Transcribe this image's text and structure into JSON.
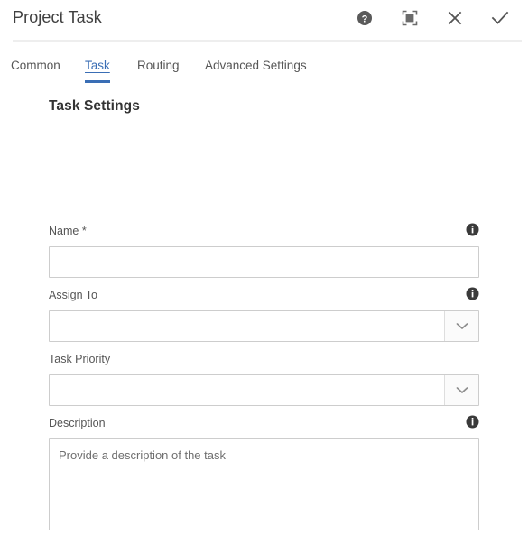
{
  "header": {
    "title": "Project Task",
    "actions": [
      {
        "name": "help-icon",
        "label": "Help"
      },
      {
        "name": "maximize-icon",
        "label": "Maximize"
      },
      {
        "name": "close-icon",
        "label": "Close"
      },
      {
        "name": "confirm-check-icon",
        "label": "Apply"
      }
    ]
  },
  "tabs": [
    {
      "label": "Common",
      "active": false
    },
    {
      "label": "Task",
      "active": true
    },
    {
      "label": "Routing",
      "active": false
    },
    {
      "label": "Advanced Settings",
      "active": false
    }
  ],
  "form": {
    "section_title": "Task Settings",
    "fields": [
      {
        "label": "Name *",
        "type": "text",
        "value": "",
        "placeholder": "",
        "has_info": true
      },
      {
        "label": "Assign To",
        "type": "select",
        "value": "",
        "placeholder": "",
        "has_info": true
      },
      {
        "label": "Task Priority",
        "type": "select",
        "value": "",
        "placeholder": "",
        "has_info": false
      },
      {
        "label": "Description",
        "type": "textarea",
        "value": "",
        "placeholder": "Provide a description of the task",
        "has_info": true
      }
    ]
  },
  "colors": {
    "accent": "#3a6eb5",
    "text": "#3c3c3c",
    "label": "#555555",
    "border": "#cdcdcd",
    "icon": "#5a5a5a",
    "info_icon": "#3a3a3a"
  }
}
